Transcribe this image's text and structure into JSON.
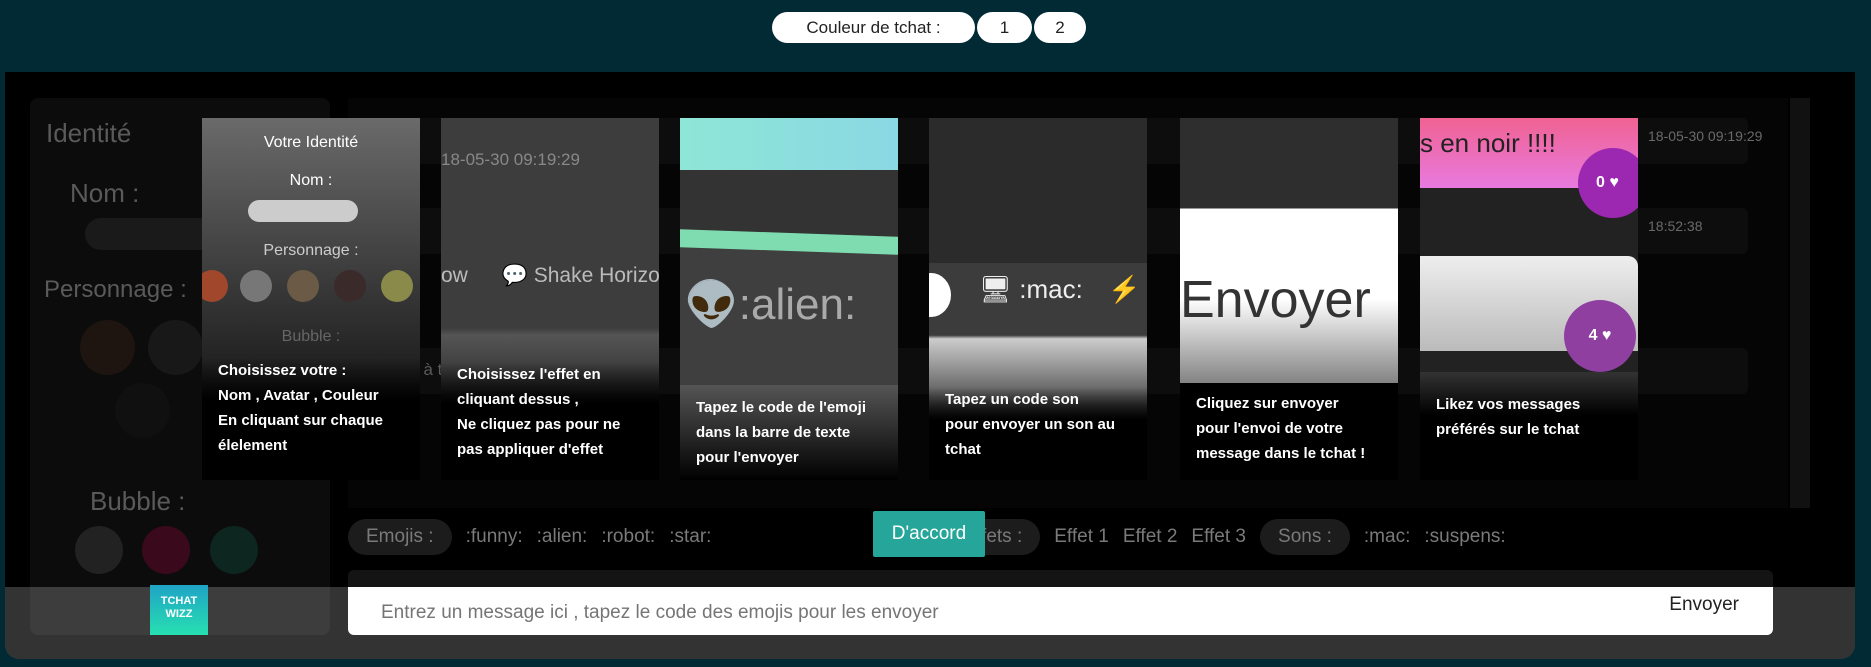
{
  "header": {
    "chat_color_label": "Couleur de tchat :",
    "color_options": [
      "1",
      "2"
    ]
  },
  "sidebar": {
    "identity_title": "Identité",
    "name_label": "Nom :",
    "character_label": "Personnage :",
    "bubble_label": "Bubble :",
    "logo_text": "TCHAT WIZZ"
  },
  "chat": {
    "fragments": [
      "18-05-30 09:19:29",
      "18:52:38",
      "Salut à tous"
    ]
  },
  "emoji_bar": {
    "emojis_label": "Emojis :",
    "emojis": [
      ":funny:",
      ":alien:",
      ":robot:",
      ":star:"
    ],
    "effects_label": "Effets :",
    "effects": [
      "Effet 1",
      "Effet 2",
      "Effet 3"
    ],
    "sounds_label": "Sons :",
    "sounds": [
      ":mac:",
      ":suspens:"
    ]
  },
  "input": {
    "placeholder": "Entrez un message ici , tapez le code des emojis pour les envoyer",
    "send_label": "Envoyer"
  },
  "tutorial": {
    "cards": [
      {
        "preview": {
          "title": "Votre Identité",
          "name": "Nom :",
          "character": "Personnage :",
          "bubble": "Bubble :"
        },
        "caption": [
          "Choisissez votre :",
          "Nom , Avatar , Couleur",
          "En cliquant sur chaque",
          "élelement"
        ]
      },
      {
        "preview": {
          "timestamp": "18-05-30 09:19:29",
          "effect_prev": "ow",
          "effect": "Shake Horizo"
        },
        "caption": [
          "Choisissez l'effet en",
          "cliquant dessus ,",
          "Ne cliquez pas pour ne",
          "pas appliquer d'effet"
        ]
      },
      {
        "preview": {
          "code": ":alien:"
        },
        "caption": [
          "Tapez le code de l'emoji",
          "dans la barre de texte",
          "pour l'envoyer"
        ]
      },
      {
        "preview": {
          "code": ":mac:"
        },
        "caption": [
          "Tapez un code son",
          "pour envoyer un son au",
          "tchat"
        ]
      },
      {
        "preview": {
          "button": "Envoyer"
        },
        "caption": [
          "Cliquez sur envoyer",
          "pour l'envoi de votre",
          "message dans le tchat !"
        ]
      },
      {
        "preview": {
          "message": "s en noir !!!!",
          "likes_1": "0",
          "likes_2": "4"
        },
        "caption": [
          "Likez vos messages",
          "préférés sur le tchat"
        ]
      }
    ],
    "confirm_label": "D'accord"
  },
  "colors": {
    "background": "#022a35",
    "accent": "#26a69a",
    "like": "#9c27b0"
  }
}
